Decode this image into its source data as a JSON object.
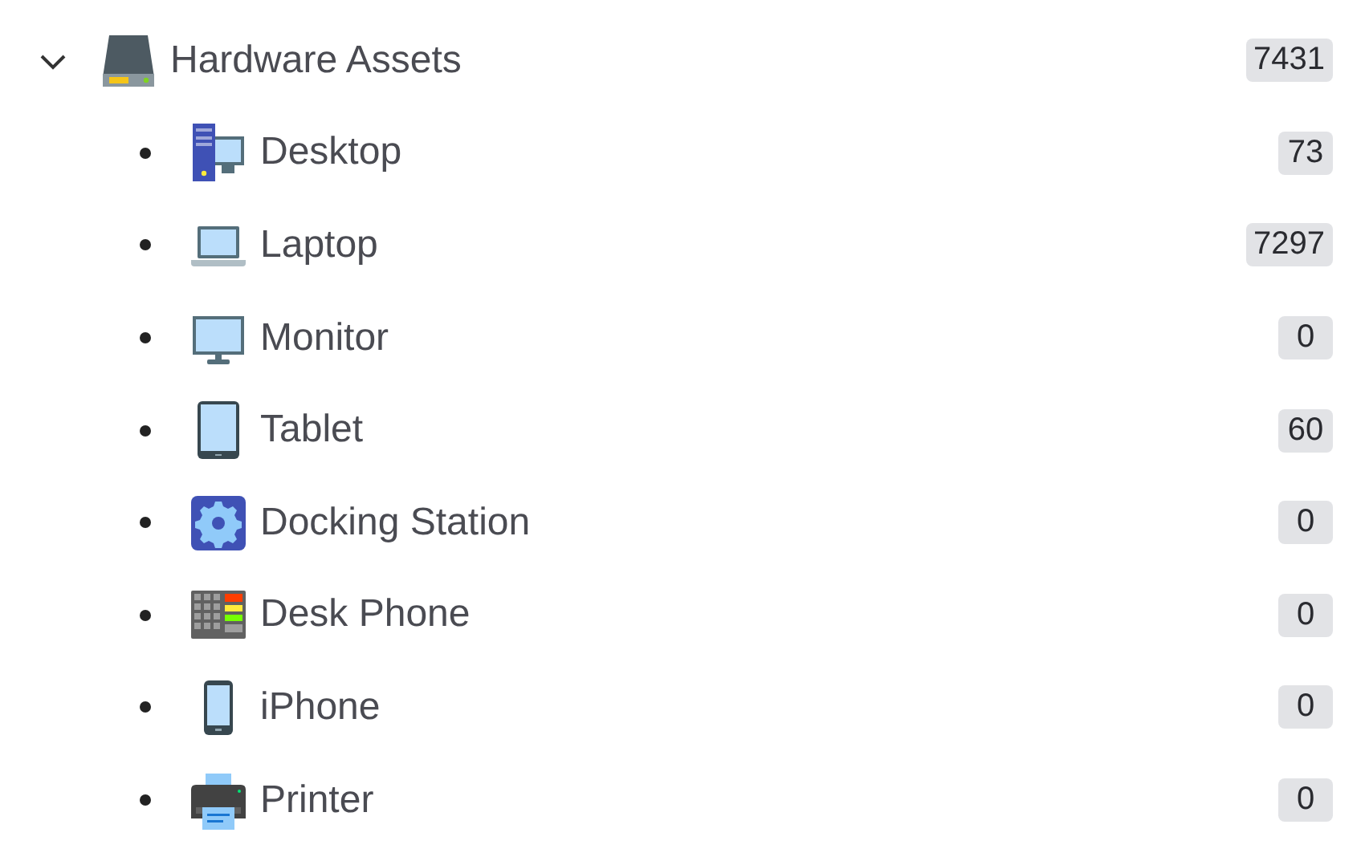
{
  "tree": {
    "label": "Hardware Assets",
    "count": "7431",
    "kind": "drive",
    "expanded": true,
    "children": [
      {
        "label": "Desktop",
        "count": "73",
        "kind": "desktop"
      },
      {
        "label": "Laptop",
        "count": "7297",
        "kind": "laptop"
      },
      {
        "label": "Monitor",
        "count": "0",
        "kind": "monitor"
      },
      {
        "label": "Tablet",
        "count": "60",
        "kind": "tablet"
      },
      {
        "label": "Docking Station",
        "count": "0",
        "kind": "gear"
      },
      {
        "label": "Desk Phone",
        "count": "0",
        "kind": "deskphone"
      },
      {
        "label": "iPhone",
        "count": "0",
        "kind": "phone"
      },
      {
        "label": "Printer",
        "count": "0",
        "kind": "printer"
      }
    ]
  }
}
